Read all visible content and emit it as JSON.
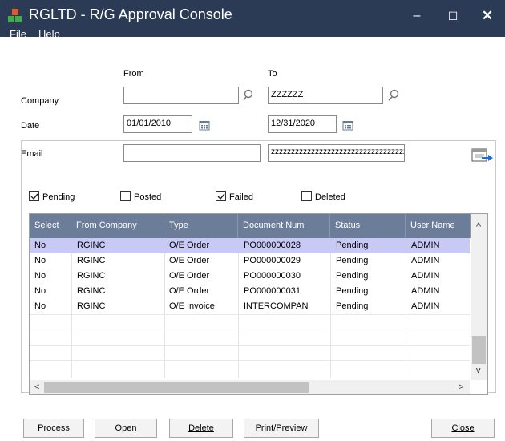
{
  "window": {
    "title": "RGLTD - R/G Approval Console",
    "minimize": "–",
    "maximize": "☐",
    "close": "✕"
  },
  "menu": {
    "file": "File",
    "help": "Help"
  },
  "range": {
    "from_header": "From",
    "to_header": "To",
    "company_label": "Company",
    "company_from": "",
    "company_to": "ZZZZZZ",
    "date_label": "Date",
    "date_from": "01/01/2010",
    "date_to": "12/31/2020",
    "email_label": "Email",
    "email_from": "",
    "email_to": "zzzzzzzzzzzzzzzzzzzzzzzzzzzzzzzzzzzzzz"
  },
  "filters": {
    "pending": {
      "label": "Pending",
      "checked": true
    },
    "posted": {
      "label": "Posted",
      "checked": false
    },
    "failed": {
      "label": "Failed",
      "checked": true
    },
    "deleted": {
      "label": "Deleted",
      "checked": false
    }
  },
  "grid": {
    "columns": [
      "Select",
      "From Company",
      "Type",
      "Document Num",
      "Status",
      "User Name"
    ],
    "rows": [
      [
        "No",
        "RGINC",
        "O/E Order",
        "PO000000028",
        "Pending",
        "ADMIN"
      ],
      [
        "No",
        "RGINC",
        "O/E Order",
        "PO000000029",
        "Pending",
        "ADMIN"
      ],
      [
        "No",
        "RGINC",
        "O/E Order",
        "PO000000030",
        "Pending",
        "ADMIN"
      ],
      [
        "No",
        "RGINC",
        "O/E Order",
        "PO000000031",
        "Pending",
        "ADMIN"
      ],
      [
        "No",
        "RGINC",
        "O/E Invoice",
        "INTERCOMPAN",
        "Pending",
        "ADMIN"
      ]
    ],
    "scroll_up": "^",
    "scroll_down": "v",
    "scroll_left": "<",
    "scroll_right": ">"
  },
  "buttons": {
    "process": "Process",
    "open": "Open",
    "delete": "Delete",
    "print_preview": "Print/Preview",
    "close": "Close"
  },
  "colors": {
    "titlebar": "#2b3a55",
    "grid_header": "#6b7d99",
    "selected_row": "#c9c9f5"
  }
}
